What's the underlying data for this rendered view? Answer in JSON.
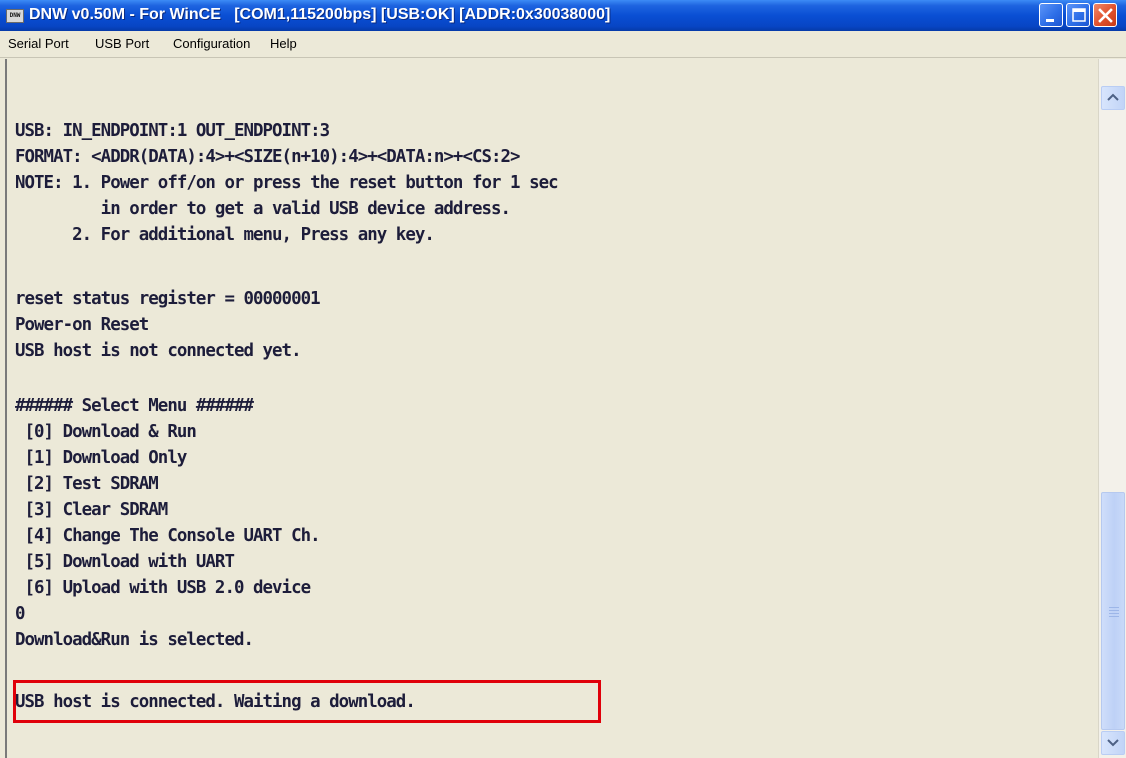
{
  "window": {
    "icon_text": "DNW",
    "title": "DNW v0.50M - For WinCE   [COM1,115200bps] [USB:OK] [ADDR:0x30038000]"
  },
  "menu": [
    {
      "label": "Serial Port"
    },
    {
      "label": "USB Port"
    },
    {
      "label": "Configuration"
    },
    {
      "label": "Help"
    }
  ],
  "console": {
    "lines": [
      "USB: IN_ENDPOINT:1 OUT_ENDPOINT:3",
      "FORMAT: <ADDR(DATA):4>+<SIZE(n+10):4>+<DATA:n>+<CS:2>",
      "NOTE: 1. Power off/on or press the reset button for 1 sec",
      "         in order to get a valid USB device address.",
      "      2. For additional menu, Press any key.",
      "",
      "reset status register = 00000001",
      "Power-on Reset",
      "USB host is not connected yet.",
      "",
      "###### Select Menu ######",
      " [0] Download & Run",
      " [1] Download Only",
      " [2] Test SDRAM",
      " [3] Clear SDRAM",
      " [4] Change The Console UART Ch.",
      " [5] Download with UART",
      " [6] Upload with USB 2.0 device",
      "0",
      "Download&Run is selected.",
      "",
      "USB host is connected. Waiting a download."
    ]
  },
  "colors": {
    "titlebar": "#0a4fd4",
    "console_bg": "#ece9d8",
    "console_text": "#1d1d3a",
    "highlight_border": "#e0000a"
  }
}
